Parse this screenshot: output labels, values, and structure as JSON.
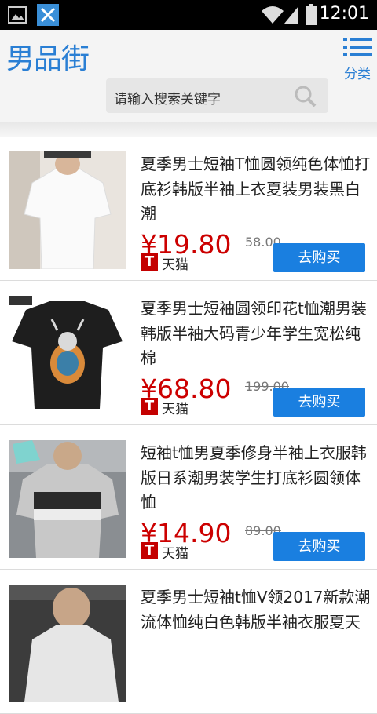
{
  "status_bar": {
    "time": "12:01",
    "icons": [
      "image-icon",
      "tools-icon",
      "wifi-icon",
      "signal-icon",
      "battery-icon"
    ]
  },
  "header": {
    "logo": "男品街",
    "category_label": "分类",
    "category_icon": "list-icon",
    "search_placeholder": "请输入搜索关键字",
    "search_icon": "search-icon"
  },
  "colors": {
    "brand_blue": "#2a7fd4",
    "price_red": "#cc0000",
    "button_blue": "#1a7fe0",
    "tmall_red": "#c40000"
  },
  "products": [
    {
      "title": "夏季男士短袖T恤圆领纯色体恤打底衫韩版半袖上衣夏装男装黑白潮",
      "price": "¥19.80",
      "original_price": "58.00",
      "tmall_badge": "T",
      "tmall_label": "天猫",
      "buy_label": "去购买"
    },
    {
      "title": "夏季男士短袖圆领印花t恤潮男装韩版半袖大码青少年学生宽松纯棉",
      "price": "¥68.80",
      "original_price": "199.00",
      "tmall_badge": "T",
      "tmall_label": "天猫",
      "buy_label": "去购买"
    },
    {
      "title": "短袖t恤男夏季修身半袖上衣服韩版日系潮男装学生打底衫圆领体恤",
      "price": "¥14.90",
      "original_price": "89.00",
      "tmall_badge": "T",
      "tmall_label": "天猫",
      "buy_label": "去购买"
    },
    {
      "title": "夏季男士短袖t恤V领2017新款潮流体恤纯白色韩版半袖衣服夏天",
      "price": "",
      "original_price": "",
      "tmall_badge": "",
      "tmall_label": "",
      "buy_label": ""
    }
  ]
}
